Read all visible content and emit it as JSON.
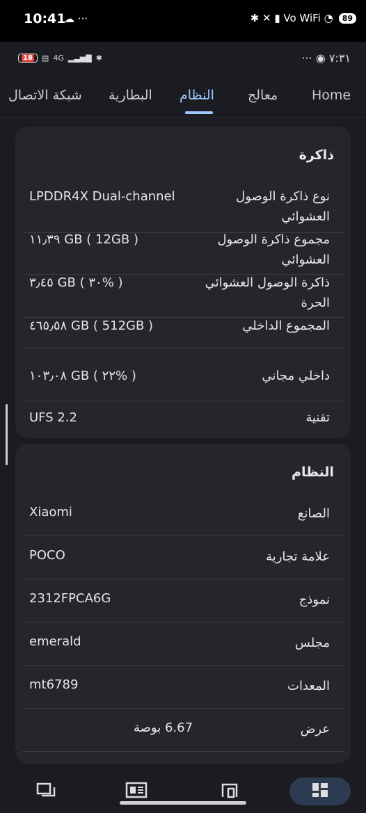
{
  "status_bar": {
    "time": "10:41",
    "left_icons": "☁ ···",
    "battery": "89",
    "right_icons": "✱ ✕ ▮ Vo WiFi ◔"
  },
  "inner_status_bar": {
    "battery": "18",
    "network": "4G",
    "right_text": "··· ◉ ٧:٣١"
  },
  "tabs": [
    {
      "label": "Home"
    },
    {
      "label": "معالج"
    },
    {
      "label": "النظام"
    },
    {
      "label": "البطارية"
    },
    {
      "label": "شبكة الاتصال"
    }
  ],
  "memory_card": {
    "title": "ذاكرة",
    "rows": [
      {
        "label": "نوع ذاكرة الوصول العشوائي",
        "value": "LPDDR4X Dual-channel"
      },
      {
        "label": "مجموع ذاكرة الوصول العشوائي",
        "value": "١١٫٣٩ GB ( 12GB )"
      },
      {
        "label": "ذاكرة الوصول العشوائي الحرة",
        "value": "٣٫٤٥ GB ( ٣٠% )"
      },
      {
        "label": "المجموع الداخلي",
        "value": "٤٦٥٫٥٨ GB ( 512GB )"
      },
      {
        "label": "داخلي مجاني",
        "value": "١٠٣٫٠٨ GB ( ٢٢% )"
      },
      {
        "label": "تقنية",
        "value": "UFS 2.2"
      }
    ]
  },
  "system_card": {
    "title": "النظام",
    "rows": [
      {
        "label": "الصانع",
        "value": "Xiaomi"
      },
      {
        "label": "علامة تجارية",
        "value": "POCO"
      },
      {
        "label": "نموذج",
        "value": "2312FPCA6G"
      },
      {
        "label": "مجلس",
        "value": "emerald"
      },
      {
        "label": "المعدات",
        "value": "mt6789"
      },
      {
        "label": "عرض",
        "value": "6.67 بوصة"
      }
    ]
  },
  "colors": {
    "accent": "#9fc7ff",
    "card": "#25262b",
    "background": "#1b1c21"
  }
}
